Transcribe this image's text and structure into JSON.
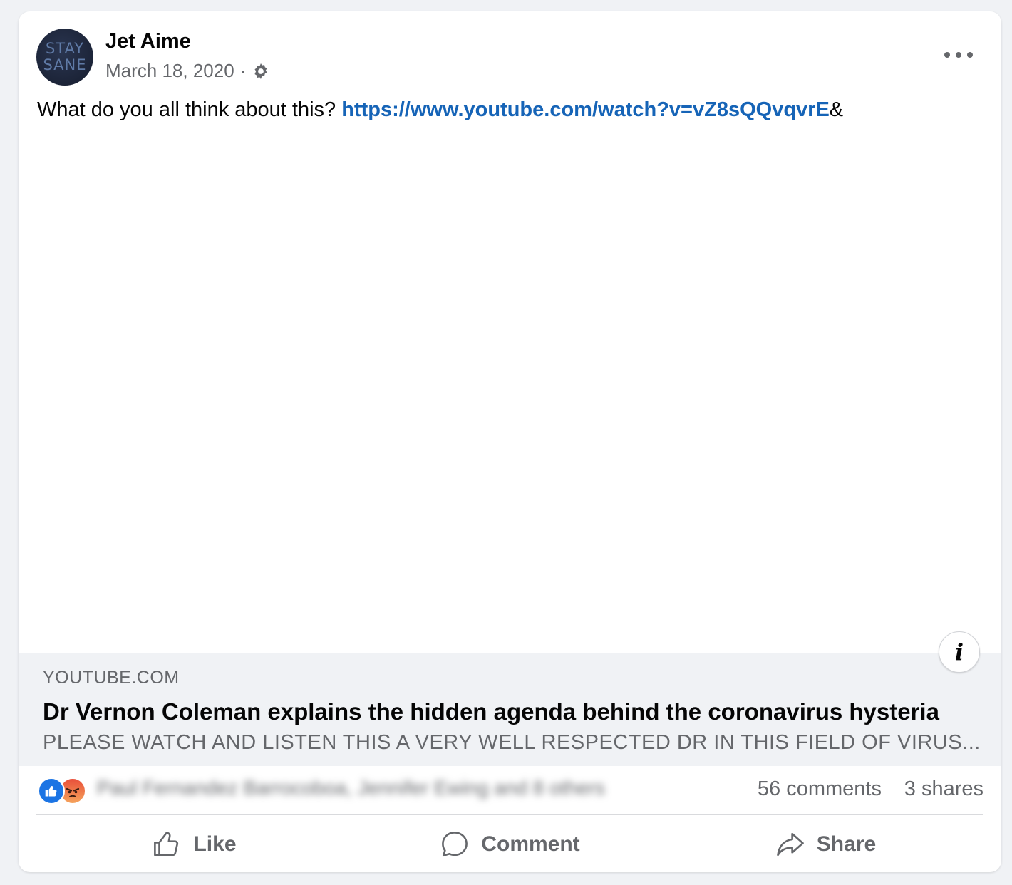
{
  "post": {
    "author": "Jet Aime",
    "avatar": {
      "line1": "STAY",
      "line2": "SANE"
    },
    "date": "March 18, 2020",
    "separator": "·",
    "text": "What do you all think about this? ",
    "link_text": "https://www.youtube.com/watch?v=vZ8sQQvqvrE",
    "text_suffix": "&"
  },
  "link_preview": {
    "domain": "YOUTUBE.COM",
    "title": "Dr Vernon Coleman explains the hidden agenda behind the coronavirus hysteria",
    "description": "PLEASE WATCH AND LISTEN THIS A VERY WELL RESPECTED DR IN THIS FIELD OF VIRUS..."
  },
  "stats": {
    "reactors": "Paul Fernandez Barrocoboa, Jennifer Ewing and 8 others",
    "comments": "56 comments",
    "shares": "3 shares"
  },
  "actions": {
    "like": "Like",
    "comment": "Comment",
    "share": "Share"
  },
  "icons": {
    "more": "more-options-icon",
    "audience": "gear-icon",
    "info": "info-icon",
    "like": "thumbs-up-icon",
    "comment": "speech-bubble-icon",
    "share": "share-arrow-icon"
  },
  "colors": {
    "link": "#1664b7",
    "secondary_text": "#65676b",
    "like_reaction": "#1b74e4",
    "background": "#f0f2f5"
  }
}
